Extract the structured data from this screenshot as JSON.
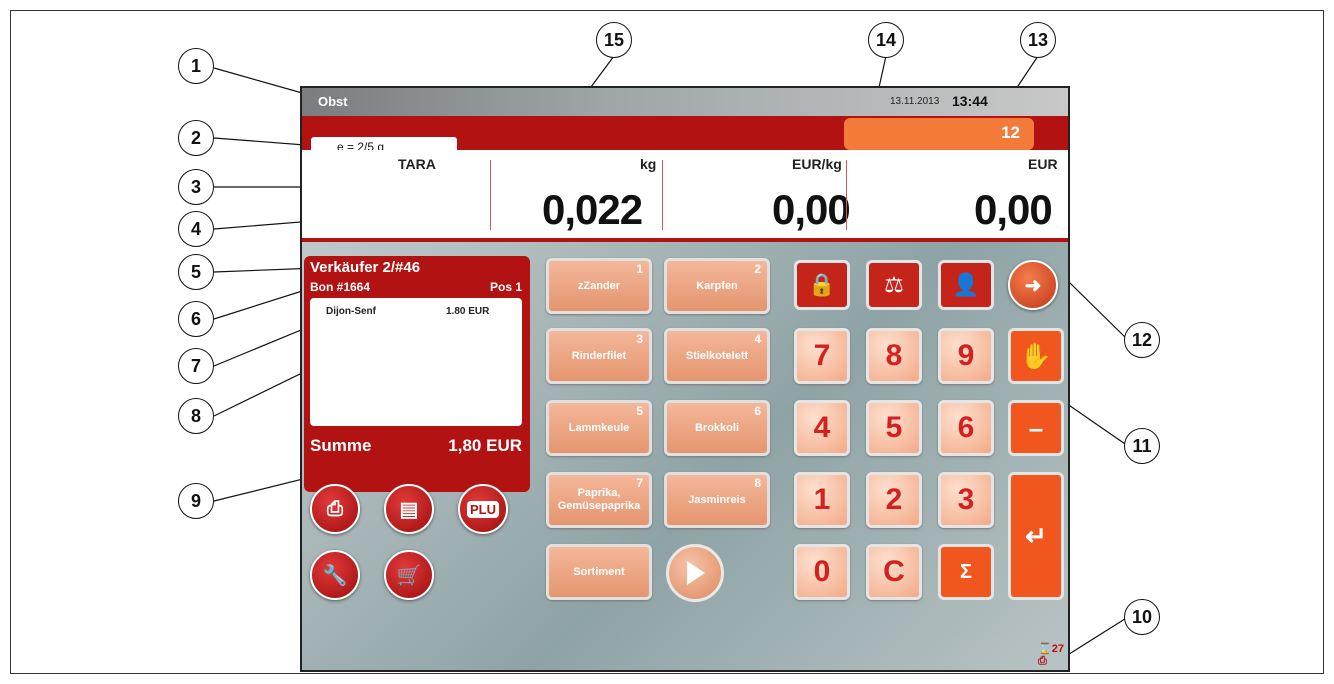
{
  "header": {
    "title": "Obst",
    "date": "13.11.2013",
    "time": "13:44",
    "counter": "12",
    "scale_interval": "e = 2/5 g"
  },
  "display": {
    "tara_label": "TARA",
    "weight_unit": "kg",
    "weight_value": "0,022",
    "price_unit": "EUR/kg",
    "price_value": "0,00",
    "total_unit": "EUR",
    "total_value": "0,00"
  },
  "receipt": {
    "seller": "Verkäufer   2/#46",
    "bon": "Bon #1664",
    "pos": "Pos 1",
    "items": [
      {
        "name": "Dijon-Senf",
        "price": "1.80 EUR"
      }
    ],
    "sum_label": "Summe",
    "sum_value": "1,80 EUR"
  },
  "plu_keys": [
    {
      "num": "1",
      "label": "zZander"
    },
    {
      "num": "2",
      "label": "Karpfen"
    },
    {
      "num": "3",
      "label": "Rinderfilet"
    },
    {
      "num": "4",
      "label": "Stielkotelett"
    },
    {
      "num": "5",
      "label": "Lammkeule"
    },
    {
      "num": "6",
      "label": "Brokkoli"
    },
    {
      "num": "7",
      "label": "Paprika, Gemüsepaprika"
    },
    {
      "num": "8",
      "label": "Jasminreis"
    }
  ],
  "sortiment_label": "Sortiment",
  "plu_button_label": "PLU",
  "numpad": [
    "7",
    "8",
    "9",
    "4",
    "5",
    "6",
    "1",
    "2",
    "3",
    "0",
    "C",
    "Σ"
  ],
  "minus_label": "–",
  "status_count": "27",
  "callouts": [
    "1",
    "2",
    "3",
    "4",
    "5",
    "6",
    "7",
    "8",
    "9",
    "10",
    "11",
    "12",
    "13",
    "14",
    "15"
  ],
  "colors": {
    "brand_red": "#b31212",
    "accent_orange": "#f0561e",
    "key_peach": "#f3a986"
  }
}
